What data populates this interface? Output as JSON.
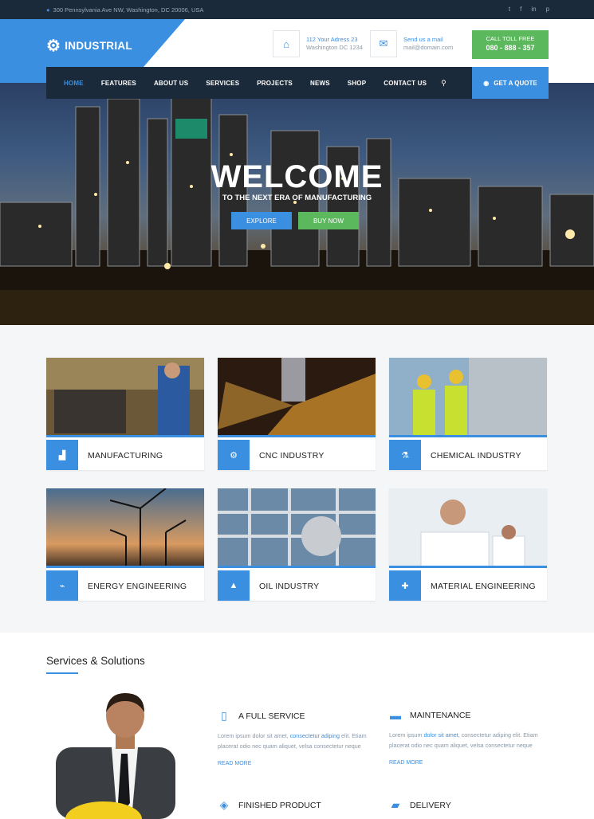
{
  "topbar": {
    "address": "300 Pennsylvania Ave NW, Washington, DC 20006, USA",
    "social": [
      "t",
      "f",
      "in",
      "p"
    ]
  },
  "header": {
    "logo_text": "INDUSTRIAL",
    "address_line1": "112 Your Adress 23",
    "address_line2": "Washington DC 1234",
    "mail_line1": "Send us a mail",
    "mail_line2": "mail@domain.com",
    "toll_label": "CALL TOLL FREE",
    "toll_number": "080 - 888 - 357"
  },
  "nav": {
    "items": [
      "HOME",
      "FEATURES",
      "ABOUT US",
      "SERVICES",
      "PROJECTS",
      "NEWS",
      "SHOP",
      "CONTACT US"
    ],
    "quote": "GET A QUOTE"
  },
  "hero": {
    "title": "WELCOME",
    "subtitle": "TO THE NEXT ERA OF MANUFACTURING",
    "explore": "EXPLORE",
    "buy": "BUY NOW"
  },
  "cards": [
    {
      "label": "MANUFACTURING",
      "icon": "factory-icon"
    },
    {
      "label": "CNC INDUSTRY",
      "icon": "gear-icon"
    },
    {
      "label": "CHEMICAL INDUSTRY",
      "icon": "flask-icon"
    },
    {
      "label": "ENERGY ENGINEERING",
      "icon": "plug-icon"
    },
    {
      "label": "OIL INDUSTRY",
      "icon": "oil-drop-icon"
    },
    {
      "label": "MATERIAL ENGINEERING",
      "icon": "puzzle-icon"
    }
  ],
  "services": {
    "title": "Services & Solutions",
    "items": [
      {
        "title": "A FULL SERVICE",
        "text_a": "Lorem ipsum dolor sit amet, ",
        "text_hl": "consectetur adiping",
        "text_b": " elit. Etiam placerat odio nec quam aliquet, velsa consectetur neque",
        "read_more": "READ MORE"
      },
      {
        "title": "MAINTENANCE",
        "text_a": "Lorem ipsum ",
        "text_hl": "dolor sit amet",
        "text_b": ", consectetur adiping elit. Etiam placerat odio nec quam aliquet, velsa consectetur neque",
        "read_more": "READ MORE"
      },
      {
        "title": "FINISHED PRODUCT"
      },
      {
        "title": "DELIVERY"
      }
    ]
  },
  "colors": {
    "accent": "#3b8fe0",
    "dark": "#1b2a3a",
    "green": "#5cb85c"
  }
}
